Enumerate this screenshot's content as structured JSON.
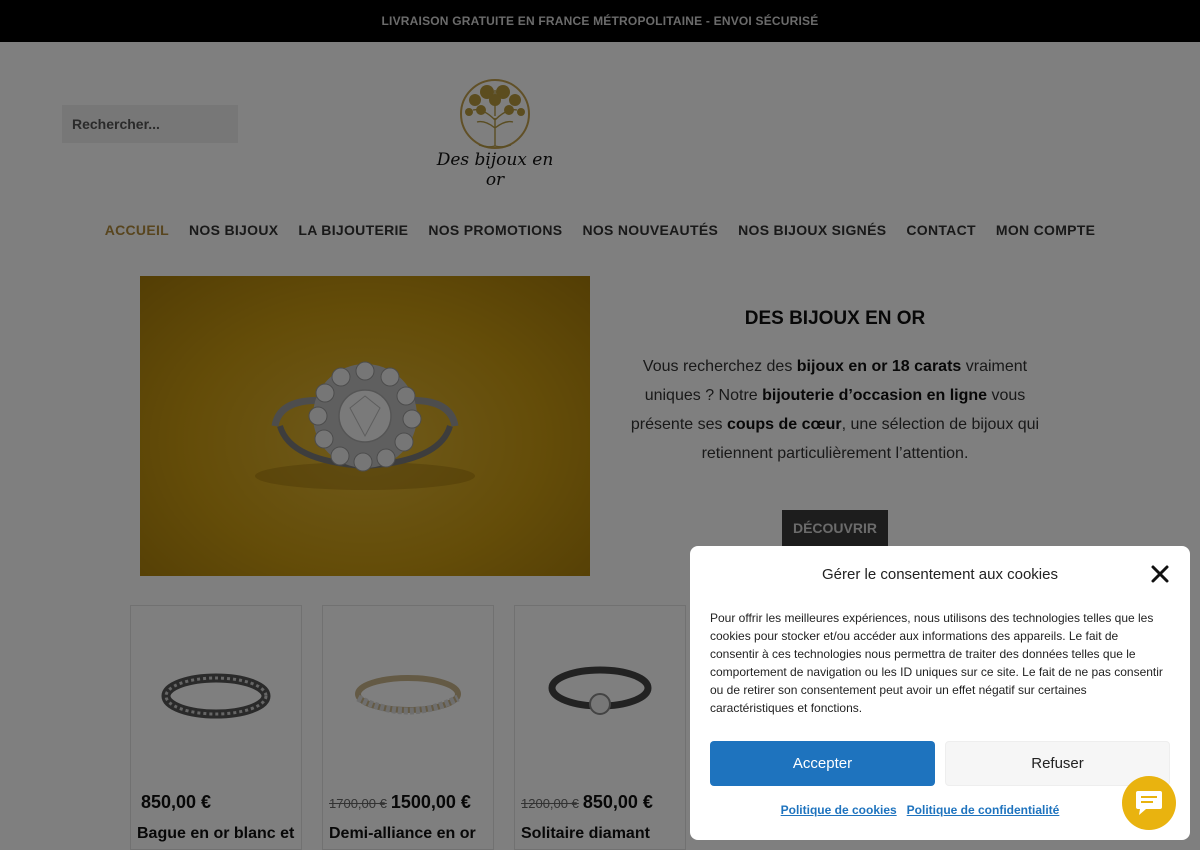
{
  "topbar": {
    "text": "LIVRAISON GRATUITE EN FRANCE MÉTROPOLITAINE - ENVOI SÉCURISÉ"
  },
  "search": {
    "placeholder": "Rechercher..."
  },
  "logo": {
    "text": "Des bijoux en or"
  },
  "nav": {
    "items": [
      {
        "label": "ACCUEIL",
        "active": true
      },
      {
        "label": "NOS BIJOUX"
      },
      {
        "label": "LA BIJOUTERIE"
      },
      {
        "label": "NOS PROMOTIONS"
      },
      {
        "label": "NOS NOUVEAUTÉS"
      },
      {
        "label": "NOS BIJOUX SIGNÉS"
      },
      {
        "label": "CONTACT"
      },
      {
        "label": "MON COMPTE"
      }
    ]
  },
  "hero": {
    "title": "DES BIJOUX EN OR",
    "p1": "Vous recherchez des ",
    "b1": "bijoux en or 18 carats",
    "p2": " vraiment uniques ? Notre ",
    "b2": "bijouterie d’occasion en ligne",
    "p3": " vous présente ses ",
    "b3": "coups de cœur",
    "p4": ", une sélection de bijoux qui retiennent particulièrement l’attention.",
    "button": "DÉCOUVRIR"
  },
  "products": [
    {
      "old_price": "",
      "price": "850,00 €",
      "name": "Bague en or blanc et"
    },
    {
      "old_price": "1700,00 €",
      "price": "1500,00 €",
      "name": "Demi-alliance en or"
    },
    {
      "old_price": "1200,00 €",
      "price": "850,00 €",
      "name": "Solitaire diamant"
    }
  ],
  "cookie": {
    "title": "Gérer le consentement aux cookies",
    "body": "Pour offrir les meilleures expériences, nous utilisons des technologies telles que les cookies pour stocker et/ou accéder aux informations des appareils. Le fait de consentir à ces technologies nous permettra de traiter des données telles que le comportement de navigation ou les ID uniques sur ce site. Le fait de ne pas consentir ou de retirer son consentement peut avoir un effet négatif sur certaines caractéristiques et fonctions.",
    "accept": "Accepter",
    "refuse": "Refuser",
    "link_cookies": "Politique de cookies",
    "link_privacy": "Politique de confidentialité"
  },
  "colors": {
    "accent": "#b08a3c",
    "button_blue": "#1e73be",
    "chat": "#e9b30f"
  },
  "icons": {
    "close": "close-icon",
    "chat": "chat-icon"
  }
}
